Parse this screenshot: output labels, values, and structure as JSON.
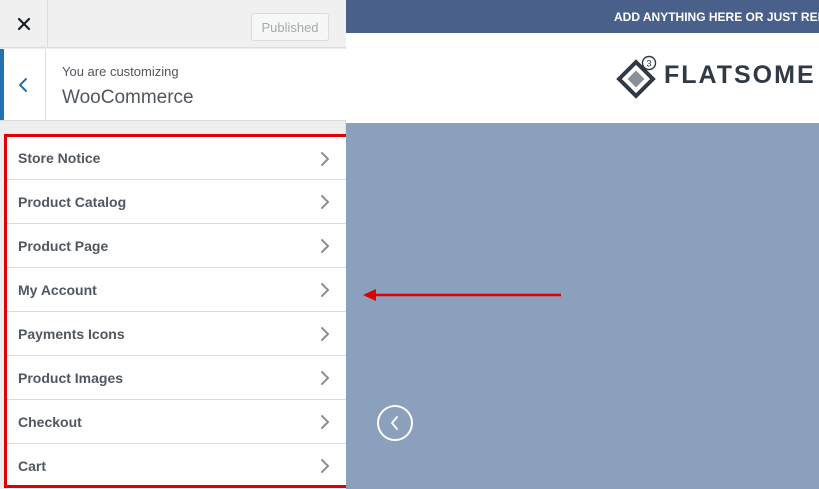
{
  "topbar": {
    "close_icon": "close-icon",
    "publish_label": "Published"
  },
  "customizing": {
    "label": "You are customizing",
    "title": "WooCommerce",
    "back_icon": "chevron-left-icon"
  },
  "sections": [
    {
      "label": "Store Notice"
    },
    {
      "label": "Product Catalog"
    },
    {
      "label": "Product Page"
    },
    {
      "label": "My Account"
    },
    {
      "label": "Payments Icons"
    },
    {
      "label": "Product Images"
    },
    {
      "label": "Checkout"
    },
    {
      "label": "Cart"
    }
  ],
  "preview": {
    "top_bar_text": "ADD ANYTHING HERE OR JUST REMOVE IT...",
    "logo_text": "FLATSOME",
    "logo_badge": "3"
  },
  "colors": {
    "accent": "#2271b1",
    "top_bar": "#48608a",
    "hero": "#8aa0bd",
    "highlight": "#e00000"
  }
}
